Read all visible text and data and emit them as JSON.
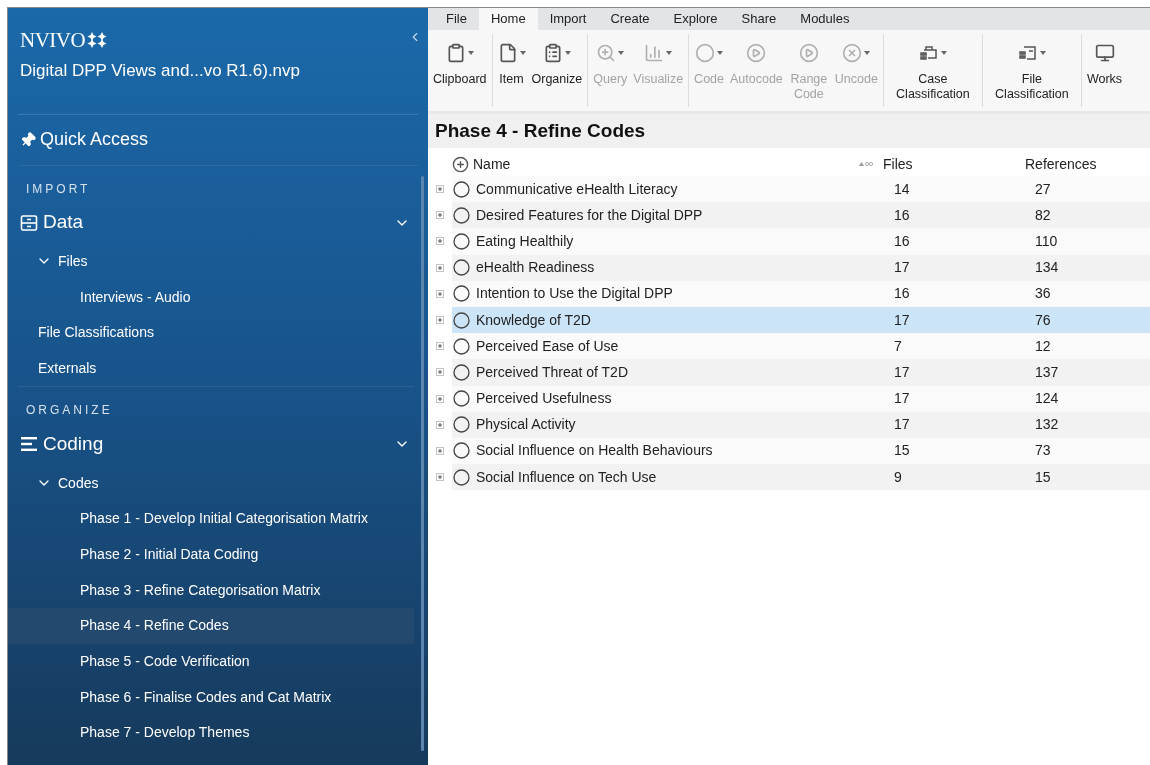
{
  "sidebar": {
    "logo": "NVIVO",
    "project": "Digital DPP Views and...vo R1.6).nvp",
    "quick_access": "Quick Access",
    "sections": [
      {
        "heading": "IMPORT",
        "group": {
          "label": "Data",
          "kind": "data",
          "expanded": true,
          "children": [
            {
              "label": "Files",
              "selected": false,
              "expanded": true,
              "children": [
                {
                  "label": "Interviews - Audio",
                  "selected": false
                }
              ]
            },
            {
              "label": "File Classifications",
              "selected": false
            },
            {
              "label": "Externals",
              "selected": false
            }
          ]
        }
      },
      {
        "heading": "ORGANIZE",
        "group": {
          "label": "Coding",
          "kind": "coding",
          "expanded": true,
          "children": [
            {
              "label": "Codes",
              "selected": false,
              "expanded": true,
              "children": [
                {
                  "label": "Phase 1 - Develop Initial Categorisation Matrix",
                  "selected": false
                },
                {
                  "label": "Phase 2 - Initial Data Coding",
                  "selected": false
                },
                {
                  "label": "Phase 3 - Refine Categorisation Matrix",
                  "selected": false
                },
                {
                  "label": "Phase 4 - Refine Codes",
                  "selected": true
                },
                {
                  "label": "Phase 5 - Code Verification",
                  "selected": false
                },
                {
                  "label": "Phase 6 - Finalise Codes and Cat Matrix",
                  "selected": false
                },
                {
                  "label": "Phase 7 - Develop Themes",
                  "selected": false
                }
              ]
            }
          ]
        }
      }
    ]
  },
  "ribbon": {
    "tabs": [
      {
        "label": "File",
        "selected": false
      },
      {
        "label": "Home",
        "selected": true
      },
      {
        "label": "Import",
        "selected": false
      },
      {
        "label": "Create",
        "selected": false
      },
      {
        "label": "Explore",
        "selected": false
      },
      {
        "label": "Share",
        "selected": false
      },
      {
        "label": "Modules",
        "selected": false
      }
    ],
    "groups": [
      [
        {
          "label": "Clipboard",
          "kind": "clipboard",
          "dropdown": true,
          "disabled": false
        }
      ],
      [
        {
          "label": "Item",
          "kind": "item",
          "dropdown": true,
          "disabled": false
        },
        {
          "label": "Organize",
          "kind": "organize",
          "dropdown": true,
          "disabled": false
        }
      ],
      [
        {
          "label": "Query",
          "kind": "query",
          "dropdown": true,
          "disabled": true
        },
        {
          "label": "Visualize",
          "kind": "visualize",
          "dropdown": true,
          "disabled": true
        }
      ],
      [
        {
          "label": "Code",
          "kind": "code",
          "dropdown": true,
          "disabled": true
        },
        {
          "label": "Autocode",
          "kind": "autocode",
          "dropdown": false,
          "disabled": true
        },
        {
          "label": "Range Code",
          "kind": "rangecode",
          "dropdown": false,
          "disabled": true
        },
        {
          "label": "Uncode",
          "kind": "uncode",
          "dropdown": true,
          "disabled": true
        }
      ],
      [
        {
          "label": "Case Classification",
          "kind": "caseclass",
          "dropdown": true,
          "disabled": false
        }
      ],
      [
        {
          "label": "File Classification",
          "kind": "fileclass",
          "dropdown": true,
          "disabled": false
        }
      ],
      [
        {
          "label": "Works",
          "kind": "workspace",
          "dropdown": false,
          "disabled": false
        }
      ]
    ]
  },
  "content": {
    "title": "Phase 4 - Refine Codes",
    "table": {
      "columns": [
        "Name",
        "Files",
        "References"
      ],
      "rows": [
        {
          "name": "Communicative eHealth Literacy",
          "files": "14",
          "references": "27",
          "selected": false
        },
        {
          "name": "Desired Features for the Digital DPP",
          "files": "16",
          "references": "82",
          "selected": false
        },
        {
          "name": "Eating Healthily",
          "files": "16",
          "references": "110",
          "selected": false
        },
        {
          "name": "eHealth Readiness",
          "files": "17",
          "references": "134",
          "selected": false
        },
        {
          "name": "Intention to Use the Digital DPP",
          "files": "16",
          "references": "36",
          "selected": false
        },
        {
          "name": "Knowledge of T2D",
          "files": "17",
          "references": "76",
          "selected": true
        },
        {
          "name": "Perceived Ease of Use",
          "files": "7",
          "references": "12",
          "selected": false
        },
        {
          "name": "Perceived Threat of T2D",
          "files": "17",
          "references": "137",
          "selected": false
        },
        {
          "name": "Perceived Usefulness",
          "files": "17",
          "references": "124",
          "selected": false
        },
        {
          "name": "Physical Activity",
          "files": "17",
          "references": "132",
          "selected": false
        },
        {
          "name": "Social Influence on Health Behaviours",
          "files": "15",
          "references": "73",
          "selected": false
        },
        {
          "name": "Social Influence on Tech Use",
          "files": "9",
          "references": "15",
          "selected": false
        }
      ]
    }
  }
}
